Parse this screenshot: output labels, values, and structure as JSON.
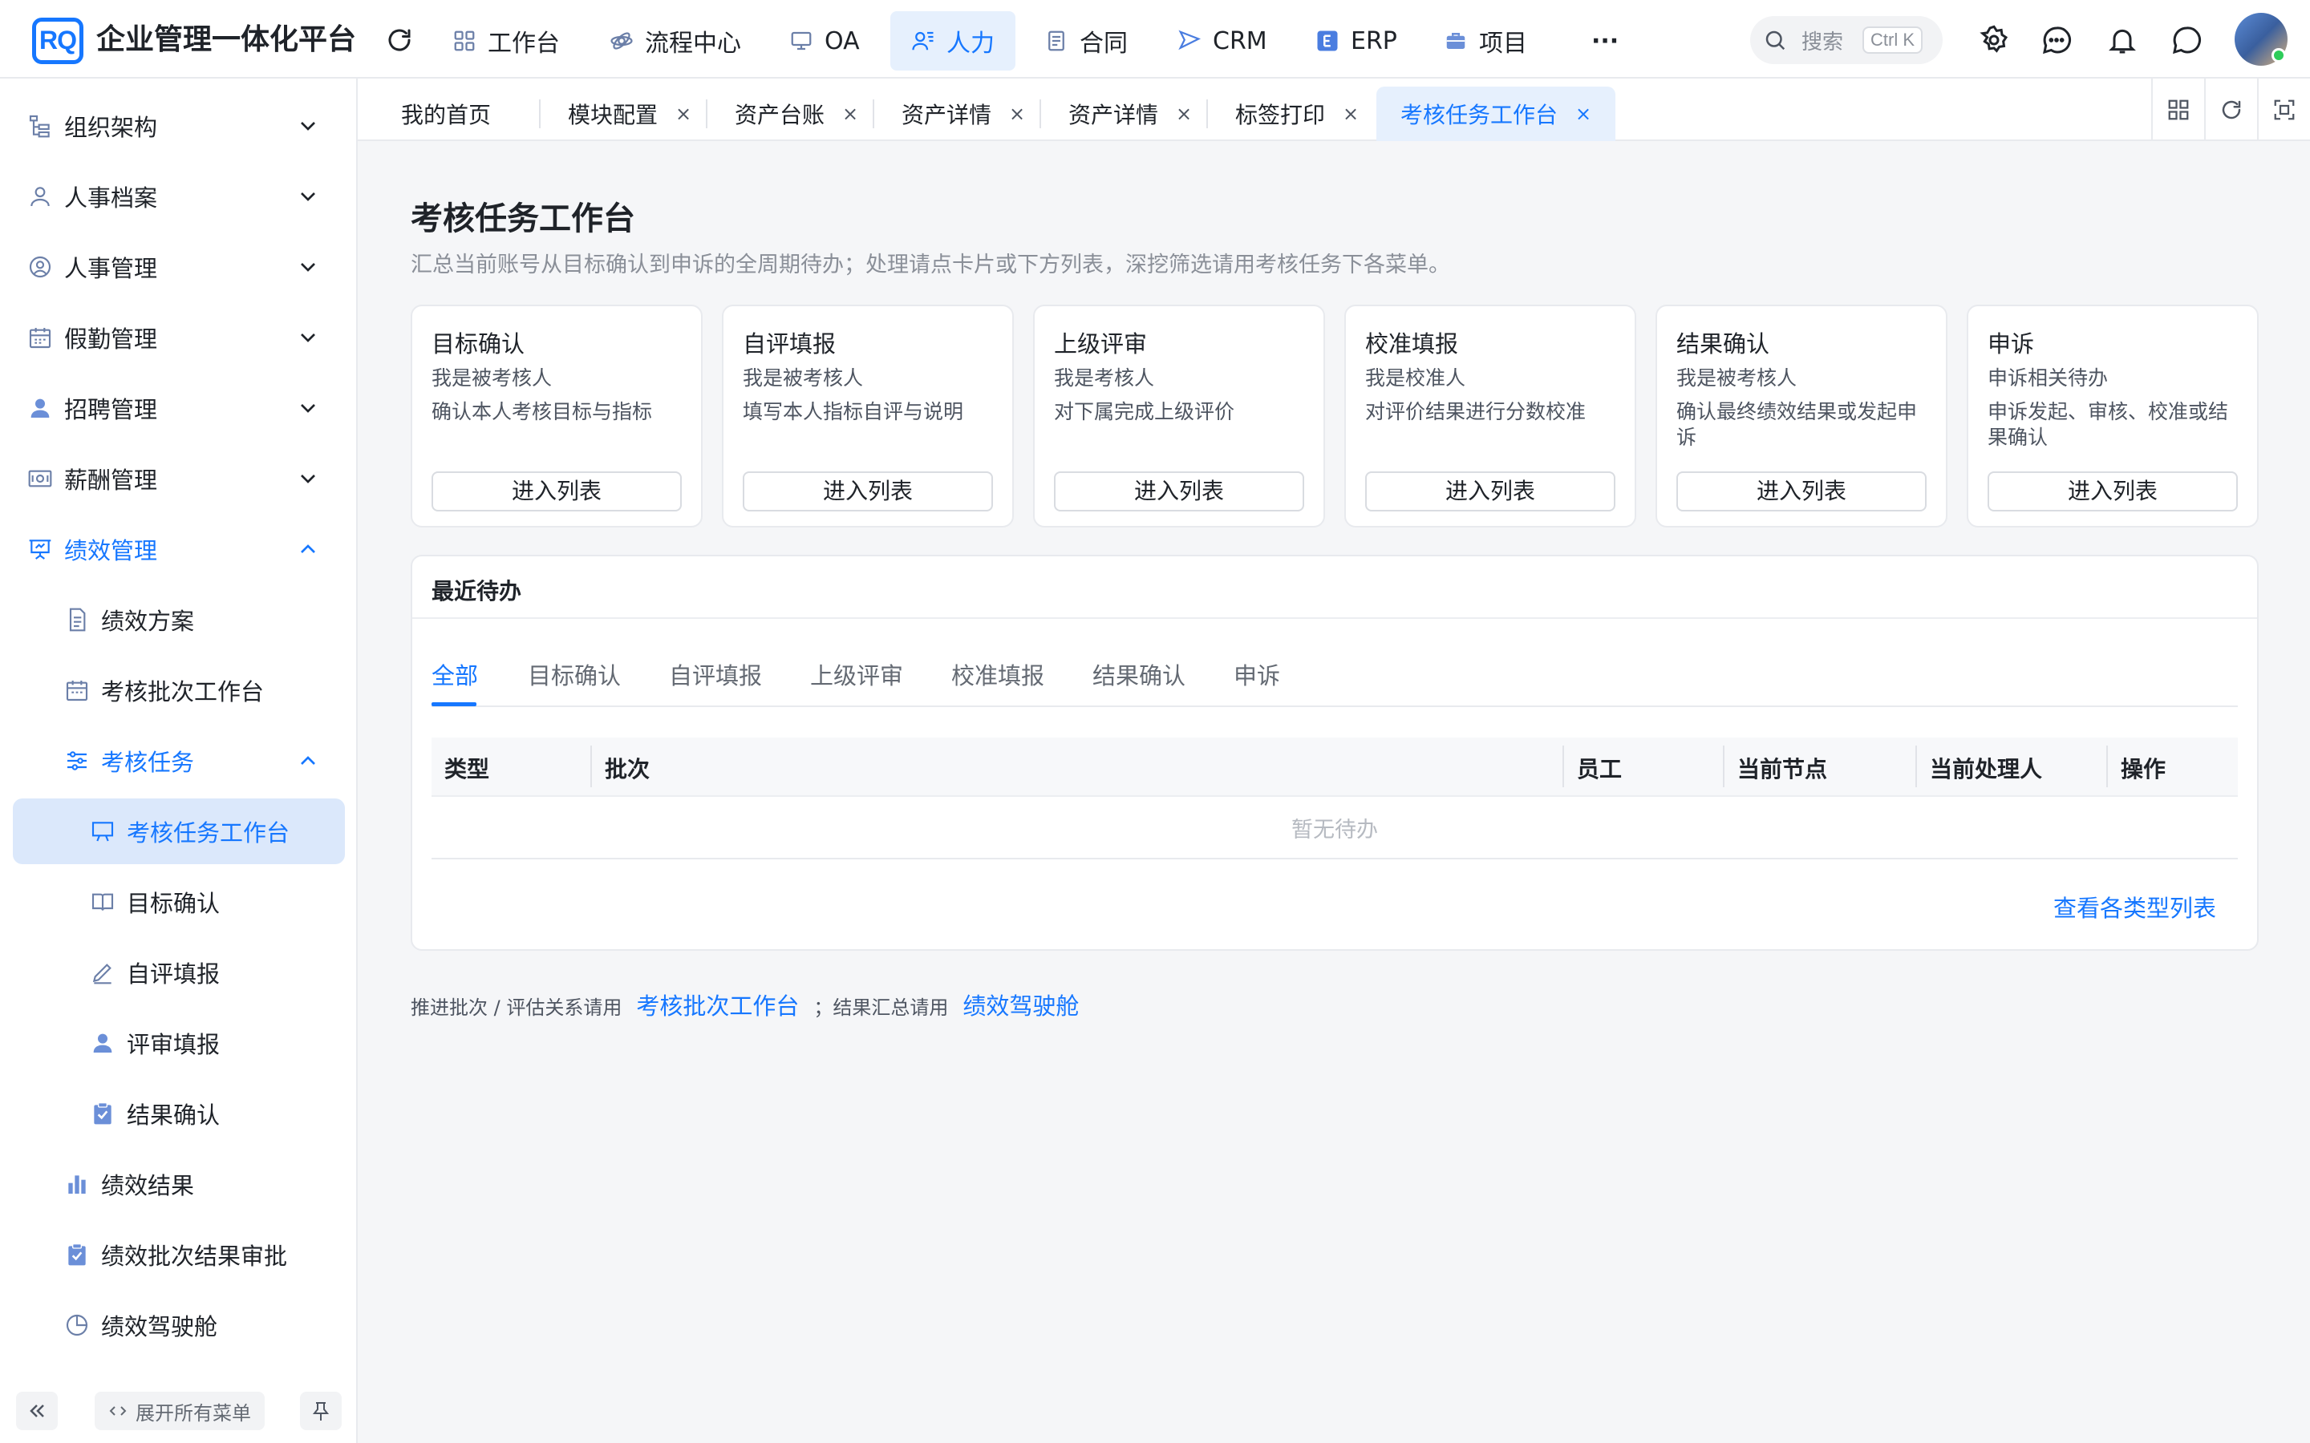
{
  "app": {
    "logo_text": "RQ",
    "title": "企业管理一体化平台"
  },
  "topnav": [
    {
      "label": "工作台",
      "icon": "dashboard-icon"
    },
    {
      "label": "流程中心",
      "icon": "flow-icon"
    },
    {
      "label": "OA",
      "icon": "monitor-icon"
    },
    {
      "label": "人力",
      "icon": "people-icon",
      "active": true
    },
    {
      "label": "合同",
      "icon": "contract-icon"
    },
    {
      "label": "CRM",
      "icon": "send-icon"
    },
    {
      "label": "ERP",
      "icon": "erp-icon"
    },
    {
      "label": "项目",
      "icon": "briefcase-icon"
    }
  ],
  "more_label": "···",
  "search": {
    "placeholder": "搜索",
    "shortcut": "Ctrl K"
  },
  "sidebar": {
    "items": [
      {
        "label": "组织架构",
        "level": 0
      },
      {
        "label": "人事档案",
        "level": 0
      },
      {
        "label": "人事管理",
        "level": 0
      },
      {
        "label": "假勤管理",
        "level": 0
      },
      {
        "label": "招聘管理",
        "level": 0
      },
      {
        "label": "薪酬管理",
        "level": 0
      },
      {
        "label": "绩效管理",
        "level": 0,
        "open": true
      },
      {
        "label": "绩效方案",
        "level": 1
      },
      {
        "label": "考核批次工作台",
        "level": 1
      },
      {
        "label": "考核任务",
        "level": 1,
        "open": true
      },
      {
        "label": "考核任务工作台",
        "level": 2,
        "selected": true
      },
      {
        "label": "目标确认",
        "level": 2
      },
      {
        "label": "自评填报",
        "level": 2
      },
      {
        "label": "评审填报",
        "level": 2
      },
      {
        "label": "结果确认",
        "level": 2
      },
      {
        "label": "绩效结果",
        "level": 1
      },
      {
        "label": "绩效批次结果审批",
        "level": 1
      },
      {
        "label": "绩效驾驶舱",
        "level": 1
      }
    ],
    "expand_all_label": "展开所有菜单",
    "collapse_label": "«"
  },
  "tabs": [
    {
      "label": "我的首页",
      "closable": false
    },
    {
      "label": "模块配置",
      "closable": true
    },
    {
      "label": "资产台账",
      "closable": true
    },
    {
      "label": "资产详情",
      "closable": true
    },
    {
      "label": "资产详情",
      "closable": true
    },
    {
      "label": "标签打印",
      "closable": true
    },
    {
      "label": "考核任务工作台",
      "closable": true,
      "active": true
    }
  ],
  "tab_close": "×",
  "page": {
    "title": "考核任务工作台",
    "description": "汇总当前账号从目标确认到申诉的全周期待办；处理请点卡片或下方列表，深挖筛选请用考核任务下各菜单。"
  },
  "cards": [
    {
      "title": "目标确认",
      "role": "我是被考核人",
      "desc": "确认本人考核目标与指标",
      "button": "进入列表"
    },
    {
      "title": "自评填报",
      "role": "我是被考核人",
      "desc": "填写本人指标自评与说明",
      "button": "进入列表"
    },
    {
      "title": "上级评审",
      "role": "我是考核人",
      "desc": "对下属完成上级评价",
      "button": "进入列表"
    },
    {
      "title": "校准填报",
      "role": "我是校准人",
      "desc": "对评价结果进行分数校准",
      "button": "进入列表"
    },
    {
      "title": "结果确认",
      "role": "我是被考核人",
      "desc": "确认最终绩效结果或发起申诉",
      "button": "进入列表"
    },
    {
      "title": "申诉",
      "role": "申诉相关待办",
      "desc": "申诉发起、审核、校准或结果确认",
      "button": "进入列表"
    }
  ],
  "todo": {
    "title": "最近待办",
    "filter_tabs": [
      "全部",
      "目标确认",
      "自评填报",
      "上级评审",
      "校准填报",
      "结果确认",
      "申诉"
    ],
    "active_filter": "全部",
    "columns": [
      "类型",
      "批次",
      "员工",
      "当前节点",
      "当前处理人",
      "操作"
    ],
    "empty_text": "暂无待办",
    "view_all": "查看各类型列表"
  },
  "footer": {
    "text1": "推进批次 / 评估关系请用",
    "link1": "考核批次工作台",
    "text2": "；结果汇总请用",
    "link2": "绩效驾驶舱"
  },
  "colors": {
    "accent": "#1677ff",
    "active_bg": "#e6f0fd",
    "selected_bg": "#dbe8fb"
  }
}
